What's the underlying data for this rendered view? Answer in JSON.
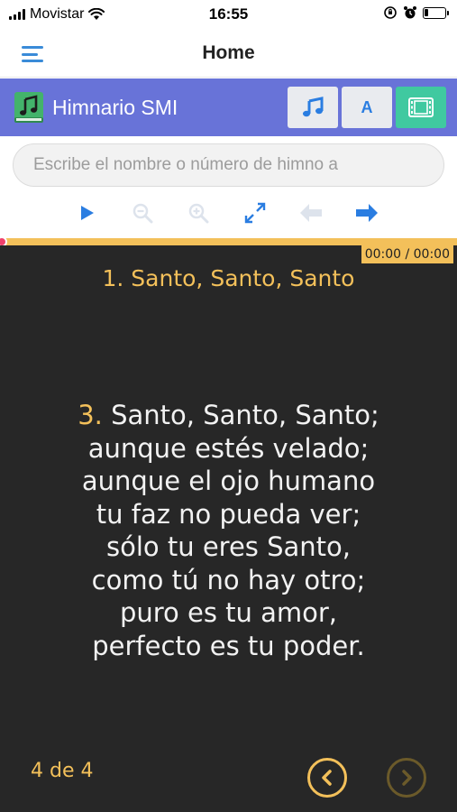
{
  "status_bar": {
    "carrier": "Movistar",
    "time": "16:55",
    "battery_level": 0.2
  },
  "header": {
    "title": "Home",
    "menu_icon": "hamburger-icon"
  },
  "app_bar": {
    "title": "Himnario SMI",
    "background_color": "#6873d8",
    "logo_icon": "hymnbook-icon",
    "modes": [
      {
        "name": "audio",
        "icon": "music-note-icon"
      },
      {
        "name": "text",
        "label": "A"
      },
      {
        "name": "video",
        "icon": "film-icon"
      }
    ]
  },
  "search": {
    "placeholder": "Escribe el nombre o número de himno a",
    "value": ""
  },
  "toolbar": {
    "icons": [
      "play-icon",
      "zoom-out-icon",
      "zoom-in-icon",
      "fullscreen-icon",
      "arrow-left-icon",
      "arrow-right-icon"
    ],
    "accent_color": "#2a7de1"
  },
  "player": {
    "time_display": "00:00 / 00:00",
    "progress": 0,
    "accent_color": "#f3c05a"
  },
  "hymn": {
    "title": "1. Santo, Santo, Santo",
    "verse_number": "3.",
    "lines": [
      "Santo, Santo, Santo;",
      "aunque estés velado;",
      "aunque el ojo humano",
      "tu faz no pueda ver;",
      "sólo tu eres Santo,",
      "como tú no hay otro;",
      "puro es tu amor,",
      "perfecto es tu poder."
    ],
    "page_indicator": "4 de 4"
  }
}
